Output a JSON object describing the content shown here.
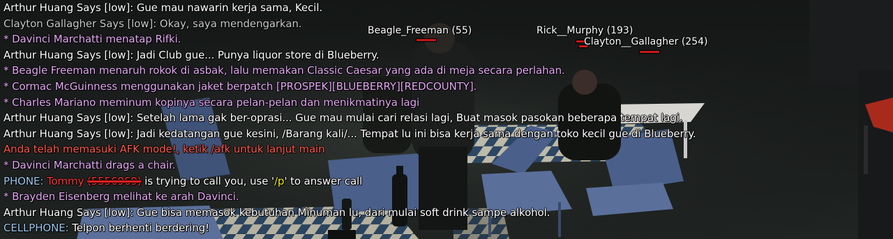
{
  "colors": {
    "say": "#ffffff",
    "say_faded": "#c8c8c8",
    "action": "#e4a8f4",
    "afk": "#ff5a4a",
    "phone_tag": "#9cc8ee",
    "caller": "#ff3a3a",
    "command": "#f0f020",
    "nametag_bar": "#c81818"
  },
  "nametags": [
    {
      "name": "Beagle_Freeman",
      "id": "(55)"
    },
    {
      "name": "Rick__Murphy",
      "id": "(193)"
    },
    {
      "name": "Clayton__Gallagher",
      "id": "(254)"
    }
  ],
  "chat": {
    "l1": "Arthur Huang Says [low]: Gue mau nawarin kerja sama, Kecil.",
    "l2": "Clayton Gallagher Says [low]: Okay, saya mendengarkan.",
    "l3": "* Davinci Marchatti menatap Rifki.",
    "l4": "Arthur Huang Says [low]: Jadi Club gue... Punya liquor store di Blueberry.",
    "l5": "* Beagle Freeman menaruh rokok di asbak, lalu memakan Classic Caesar yang ada di meja secara perlahan.",
    "l6": "* Cormac McGuinness menggunakan jaket berpatch [PROSPEK][BLUEBERRY][REDCOUNTY].",
    "l7": "* Charles Mariano meminum kopinya secara pelan-pelan dan menikmatinya lagi",
    "l8": "Arthur Huang Says [low]: Setelah lama gak ber-oprasi... Gue mau mulai cari relasi lagi, Buat masok pasokan beberapa tempat lagi.",
    "l9": "Arthur Huang Says [low]: Jadi kedatangan gue kesini, /Barang kali/... Tempat lu ini bisa kerja sama dengan toko kecil gue di Blueberry.",
    "l10": "Anda telah memasuki AFK mode!, ketik /afk untuk lanjut main",
    "l11": "* Davinci Marchatti drags a chair.",
    "l12": {
      "prefix": "PHONE: ",
      "caller": "Tommy",
      "number": "(5556969)",
      "middle": " is trying to call you, use '",
      "command": "/p",
      "suffix": "' to answer call"
    },
    "l13": "* Brayden Eisenberg melihat ke arah Davinci.",
    "l14": "Arthur Huang Says [low]: Gue bisa memasok kebutuhan Minuman lu, dari mulai soft drink sampe alkohol.",
    "l15": {
      "prefix": "CELLPHONE: ",
      "text": "Telpon berhenti berdering!"
    }
  }
}
